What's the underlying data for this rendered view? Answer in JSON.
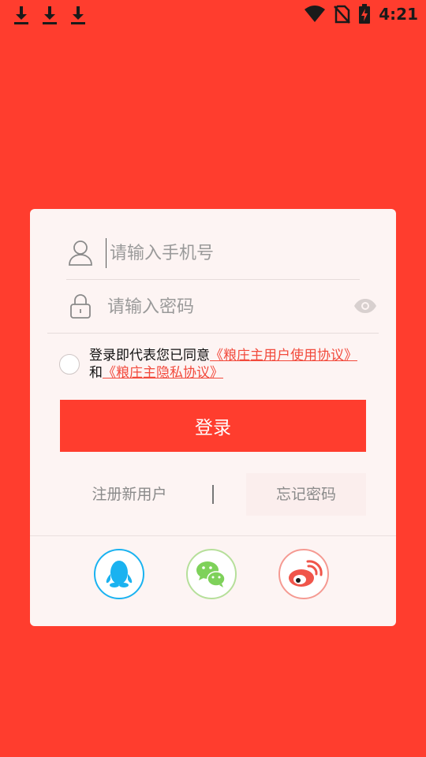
{
  "status_bar": {
    "time": "4:21",
    "left_icons": [
      "download-icon",
      "download-icon",
      "download-icon"
    ],
    "right_icons": [
      "wifi-icon",
      "no-sim-icon",
      "battery-charging-icon"
    ]
  },
  "form": {
    "phone_placeholder": "请输入手机号",
    "password_placeholder": "请输入密码",
    "agreement": {
      "prefix": "登录即代表您已同意",
      "user_agreement": "《粮庄主用户使用协议》",
      "and": "和",
      "privacy_agreement": "《粮庄主隐私协议》"
    },
    "login_label": "登录",
    "register_label": "注册新用户",
    "forgot_label": "忘记密码"
  },
  "social_login": [
    {
      "name": "qq-icon",
      "color": "#1ab2f0"
    },
    {
      "name": "wechat-icon",
      "color": "#7ed15a"
    },
    {
      "name": "weibo-icon",
      "color": "#f0554a"
    }
  ],
  "colors": {
    "background": "#ff3d2e",
    "card": "#fdf4f3",
    "link": "#f24a3c"
  }
}
